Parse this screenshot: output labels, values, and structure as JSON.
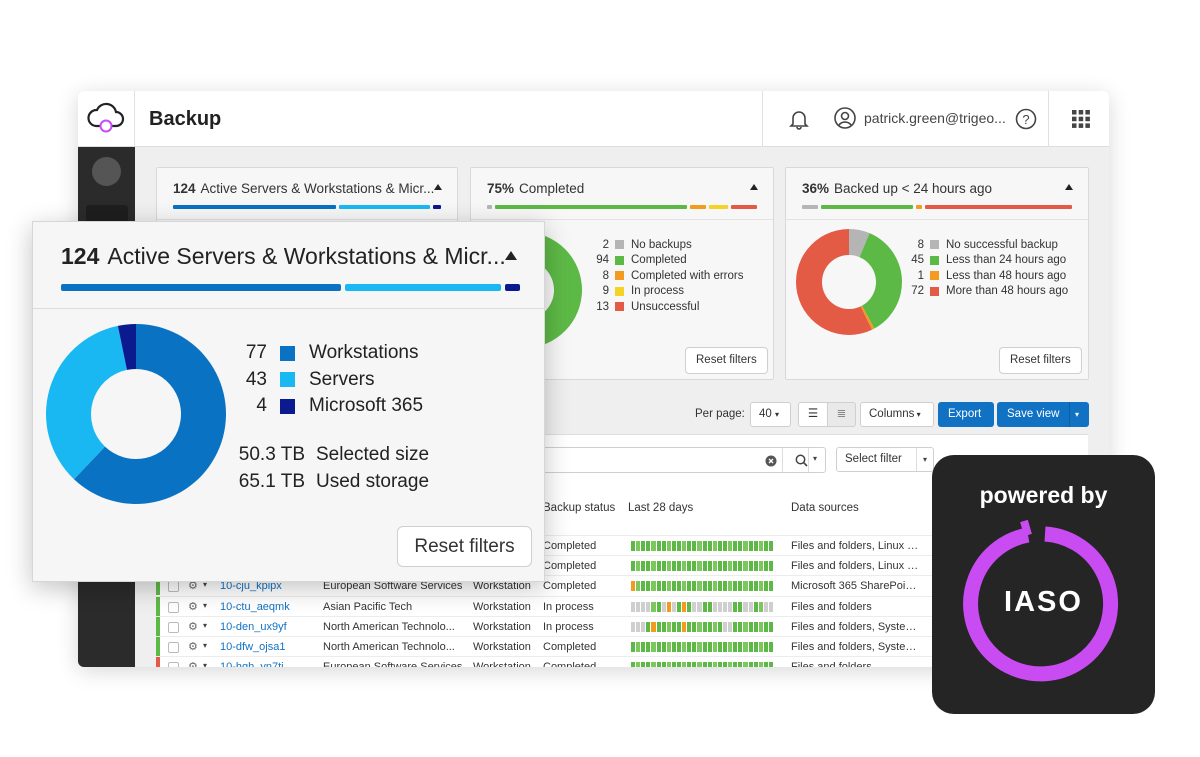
{
  "header": {
    "app_title": "Backup",
    "user": "patrick.green@trigeo...",
    "icons": [
      "cloud-sync-icon",
      "bell-icon",
      "user-icon",
      "help-icon",
      "apps-grid-icon"
    ]
  },
  "cards": [
    {
      "count": "124",
      "title": "Active Servers & Workstations & Micr...",
      "segments": [
        {
          "value": 77,
          "color": "#0a72c2"
        },
        {
          "value": 43,
          "color": "#1ab8f2"
        },
        {
          "value": 4,
          "color": "#0c1a8f"
        }
      ]
    },
    {
      "count": "75%",
      "title": "Completed",
      "segments": [
        {
          "value": 2,
          "color": "#b5b5b5"
        },
        {
          "value": 94,
          "color": "#5db946"
        },
        {
          "value": 8,
          "color": "#f29b1f"
        },
        {
          "value": 9,
          "color": "#f5d226"
        },
        {
          "value": 13,
          "color": "#e35b45"
        }
      ],
      "legend": [
        {
          "count": "2",
          "label": "No backups",
          "color": "#b5b5b5"
        },
        {
          "count": "94",
          "label": "Completed",
          "color": "#5db946"
        },
        {
          "count": "8",
          "label": "Completed with errors",
          "color": "#f29b1f"
        },
        {
          "count": "9",
          "label": "In process",
          "color": "#f5d226"
        },
        {
          "count": "13",
          "label": "Unsuccessful",
          "color": "#e35b45"
        }
      ],
      "reset": "Reset filters"
    },
    {
      "count": "36%",
      "title": "Backed up < 24 hours ago",
      "segments": [
        {
          "value": 8,
          "color": "#b5b5b5"
        },
        {
          "value": 45,
          "color": "#5db946"
        },
        {
          "value": 1,
          "color": "#f29b1f"
        },
        {
          "value": 72,
          "color": "#e35b45"
        }
      ],
      "legend": [
        {
          "count": "8",
          "label": "No successful backup",
          "color": "#b5b5b5"
        },
        {
          "count": "45",
          "label": "Less than 24 hours ago",
          "color": "#5db946"
        },
        {
          "count": "1",
          "label": "Less than 48 hours ago",
          "color": "#f29b1f"
        },
        {
          "count": "72",
          "label": "More than 48 hours ago",
          "color": "#e35b45"
        }
      ],
      "reset": "Reset filters"
    }
  ],
  "toolbar": {
    "per_page_label": "Per page:",
    "per_page_value": "40",
    "columns": "Columns",
    "export": "Export",
    "save_view": "Save view",
    "select_filter": "Select filter"
  },
  "table": {
    "headers": {
      "status": "Backup status",
      "history": "Last 28 days",
      "sources": "Data sources"
    },
    "rows": [
      {
        "name": "",
        "customer": "",
        "type": "",
        "status": "Completed",
        "sources": "Files and folders, Linux s...",
        "flag": "#5db946",
        "history": "GGGGGGGGGGGGGGGGGGGGGGGGGGGG"
      },
      {
        "name": "",
        "customer": "",
        "type": "",
        "status": "Completed",
        "sources": "Files and folders, Linux s...",
        "flag": "#5db946",
        "history": "GGGGGGGGGGGGGGGGGGGGGGGGGGGG"
      },
      {
        "name": "10-cju_kpipx",
        "customer": "European Software Services",
        "type": "Workstation",
        "status": "Completed",
        "sources": "Microsoft 365 SharePoin...",
        "flag": "#5db946",
        "history": "OGGGGGGGGGGGGGGGGGGGGGGGGGGG"
      },
      {
        "name": "10-ctu_aeqmk",
        "customer": "Asian Pacific Tech",
        "type": "Workstation",
        "status": "In process",
        "sources": "Files and folders",
        "flag": "#5db946",
        "history": "XXXXGGXOXGOGXXGGXXXXGGXXGGXX"
      },
      {
        "name": "10-den_ux9yf",
        "customer": "North American Technolo...",
        "type": "Workstation",
        "status": "In process",
        "sources": "Files and folders, System...",
        "flag": "#5db946",
        "history": "XXXGOGGGGGOGGGGGGGXXGGGGGGGG"
      },
      {
        "name": "10-dfw_ojsa1",
        "customer": "North American Technolo...",
        "type": "Workstation",
        "status": "Completed",
        "sources": "Files and folders, System...",
        "flag": "#5db946",
        "history": "GGGGGGGGGGGGGGGGGGGGGGGGGGGG"
      },
      {
        "name": "10-hgh_yn7ti",
        "customer": "European Software Services",
        "type": "Workstation",
        "status": "Completed",
        "sources": "Files and folders",
        "flag": "#e35b45",
        "history": "GGGGGGGGGGGGGGGGGGGGGGGGGGGG"
      }
    ]
  },
  "zoom_panel": {
    "count": "124",
    "title": "Active Servers & Workstations & Micr...",
    "legend": [
      {
        "count": "77",
        "label": "Workstations",
        "color": "#0a72c2"
      },
      {
        "count": "43",
        "label": "Servers",
        "color": "#1ab8f2"
      },
      {
        "count": "4",
        "label": "Microsoft 365",
        "color": "#0c1a8f"
      }
    ],
    "stats": [
      {
        "value": "50.3 TB",
        "label": "Selected size"
      },
      {
        "value": "65.1 TB",
        "label": "Used storage"
      }
    ],
    "reset": "Reset filters"
  },
  "badge": {
    "text": "powered by",
    "logo": "IASO",
    "accent": "#c94cf2"
  }
}
